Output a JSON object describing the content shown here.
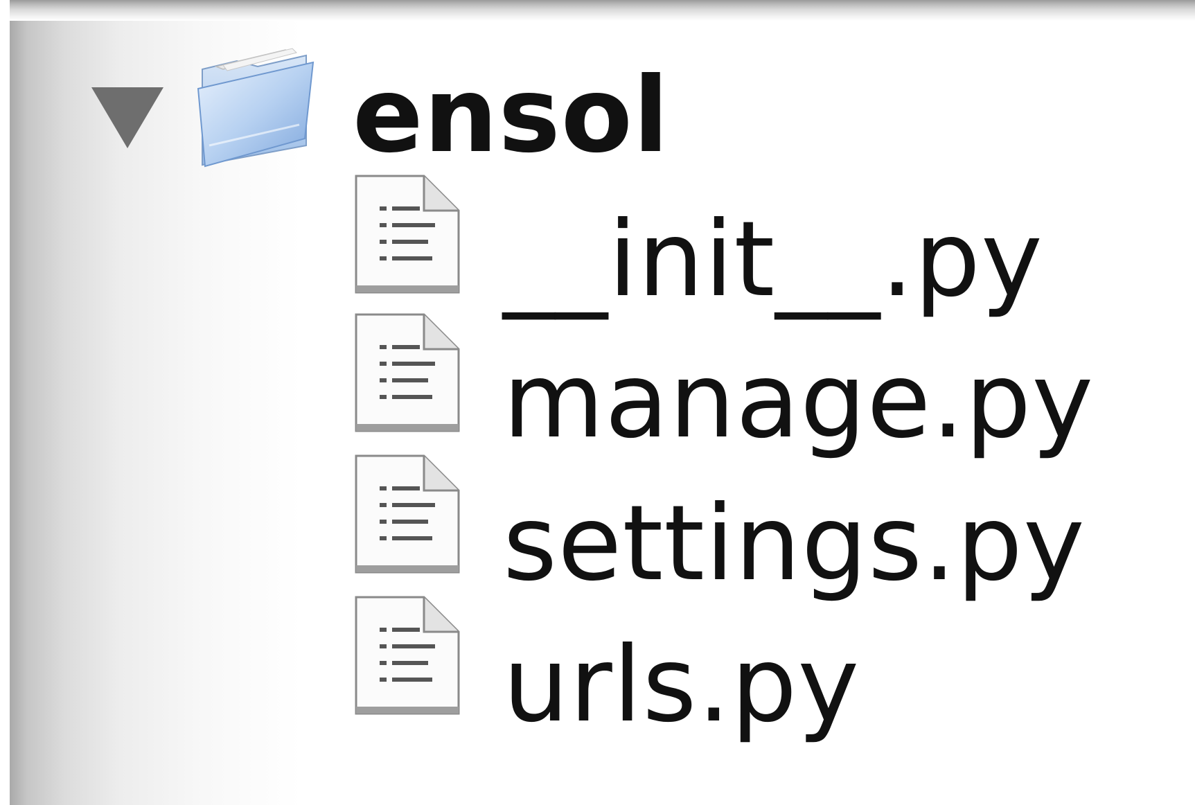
{
  "tree": {
    "folder": {
      "name": "ensol",
      "expanded": true,
      "icon": "folder-icon"
    },
    "files": [
      {
        "name": "__init__.py",
        "icon": "text-file-icon"
      },
      {
        "name": "manage.py",
        "icon": "text-file-icon"
      },
      {
        "name": "settings.py",
        "icon": "text-file-icon"
      },
      {
        "name": "urls.py",
        "icon": "text-file-icon"
      }
    ]
  },
  "colors": {
    "disclosure": "#6e6e6e",
    "folder_blue": "#8fb6e6",
    "text": "#111111"
  }
}
